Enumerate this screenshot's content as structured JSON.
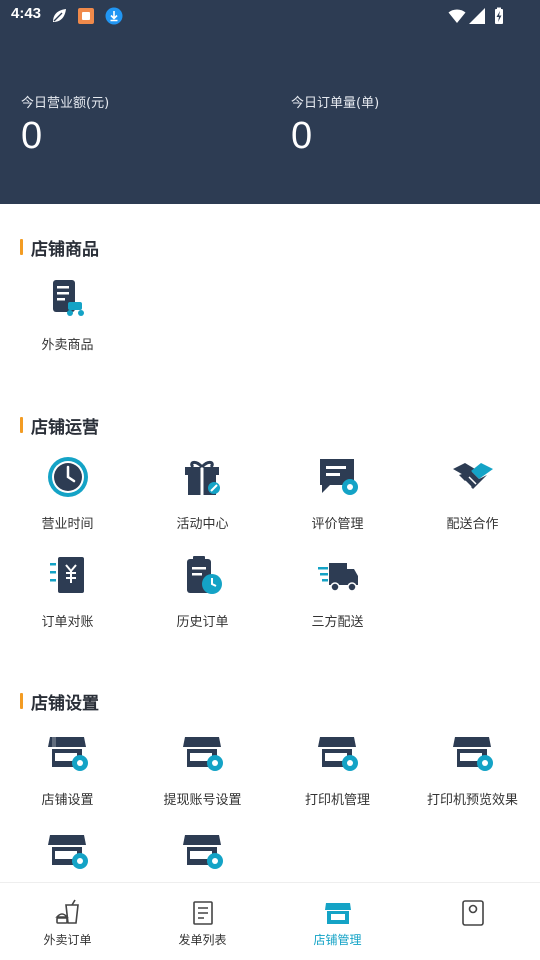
{
  "status_bar": {
    "time": "4:43"
  },
  "summary": {
    "revenue_label": "今日营业额(元)",
    "revenue_value": "0",
    "orders_label": "今日订单量(单)",
    "orders_value": "0"
  },
  "sections": [
    {
      "title": "店铺商品",
      "items": [
        {
          "label": "外卖商品",
          "icon": "takeout-goods-icon"
        }
      ]
    },
    {
      "title": "店铺运营",
      "items": [
        {
          "label": "营业时间",
          "icon": "clock-icon"
        },
        {
          "label": "活动中心",
          "icon": "gift-icon"
        },
        {
          "label": "评价管理",
          "icon": "comment-settings-icon"
        },
        {
          "label": "配送合作",
          "icon": "handshake-icon"
        },
        {
          "label": "订单对账",
          "icon": "yuan-receipt-icon"
        },
        {
          "label": "历史订单",
          "icon": "clipboard-clock-icon"
        },
        {
          "label": "三方配送",
          "icon": "delivery-truck-icon"
        }
      ]
    },
    {
      "title": "店铺设置",
      "items": [
        {
          "label": "店铺设置",
          "icon": "store-gear-icon"
        },
        {
          "label": "提现账号设置",
          "icon": "store-gear-icon"
        },
        {
          "label": "打印机管理",
          "icon": "store-gear-icon"
        },
        {
          "label": "打印机预览效果",
          "icon": "store-gear-icon"
        },
        {
          "label": "",
          "icon": "store-gear-icon"
        },
        {
          "label": "",
          "icon": "store-gear-icon"
        }
      ]
    }
  ],
  "bottom_nav": [
    {
      "label": "外卖订单",
      "icon": "drink-burger-icon",
      "active": false
    },
    {
      "label": "发单列表",
      "icon": "document-list-icon",
      "active": false
    },
    {
      "label": "店铺管理",
      "icon": "store-icon",
      "active": true
    },
    {
      "label": "",
      "icon": "user-card-icon",
      "active": false
    }
  ],
  "colors": {
    "header_bg": "#2d3c53",
    "accent_orange": "#f39c23",
    "icon_dark": "#2d3c53",
    "icon_cyan": "#14a3c6"
  }
}
